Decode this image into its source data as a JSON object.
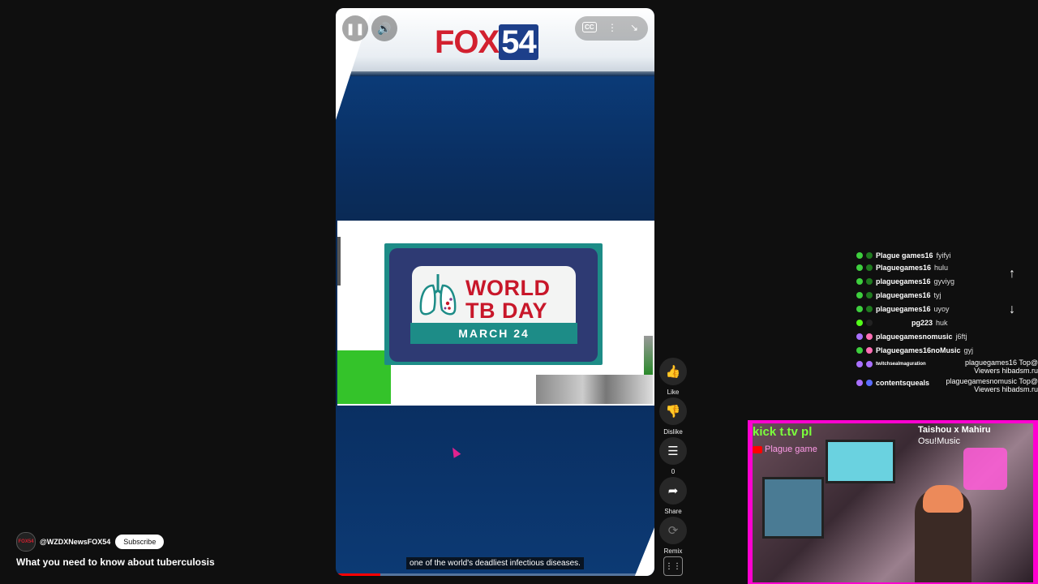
{
  "player": {
    "logo_fox": "FOX",
    "logo_num": "54",
    "cc_label": "CC",
    "caption": "one of the world's deadliest infectious diseases.",
    "progress_fraction": 0.14
  },
  "tb_card": {
    "line1": "WORLD",
    "line2": "TB DAY",
    "date": "MARCH 24"
  },
  "actions": {
    "like": "Like",
    "dislike": "Dislike",
    "comments": "0",
    "share": "Share",
    "remix": "Remix"
  },
  "channel": {
    "avatar_text": "FOX54",
    "handle": "@WZDXNewsFOX54",
    "subscribe": "Subscribe",
    "video_title": "What you need to know about tuberculosis"
  },
  "chat": {
    "rows": [
      {
        "user": "Plague games16",
        "msg": "fyifyi",
        "color": "#3ecf3e"
      },
      {
        "user": "Plaguegames16",
        "msg": "hulu",
        "color": "#3ecf3e"
      },
      {
        "user": "plaguegames16",
        "msg": "gyviyg",
        "color": "#3ecf3e"
      },
      {
        "user": "plaguegames16",
        "msg": "tyj",
        "color": "#3ecf3e"
      },
      {
        "user": "plaguegames16",
        "msg": "uyoy",
        "color": "#3ecf3e"
      },
      {
        "user": "pg223",
        "msg": "huk",
        "color": "#53fc18"
      },
      {
        "user": "plaguegamesnomusic",
        "msg": "j6ftj",
        "color": "#ff6fb5"
      },
      {
        "user": "Plaguegames16noMusic",
        "msg": "gyj",
        "color": "#ff6fb5"
      },
      {
        "user": "twitchsealmaguration",
        "msg": "",
        "color": "#a970ff"
      },
      {
        "user": "contentsqueals",
        "msg": "",
        "color": "#a970ff"
      }
    ],
    "right_1a": "plaguegames16 Top@",
    "right_1b": "Viewers hibadsm.ru",
    "right_2a": "plaguegamesnomusic Top@",
    "right_2b": "Viewers hibadsm.ru"
  },
  "webcam": {
    "kick": "kick t.tv pl",
    "plague": "Plague game",
    "title": "Taishou x Mahiru",
    "subtitle": "Osu!Music"
  }
}
